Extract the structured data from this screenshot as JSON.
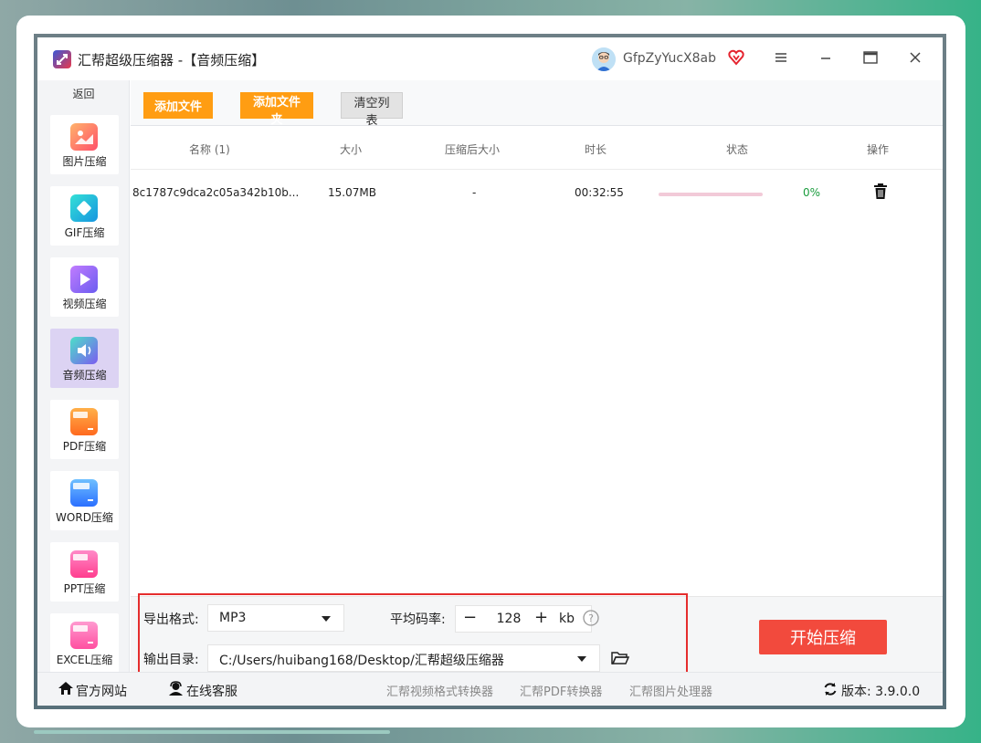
{
  "window": {
    "app_name": "汇帮超级压缩器",
    "section": " -【音频压缩】",
    "username": "GfpZyYucX8ab"
  },
  "sidebar": {
    "back_label": "返回",
    "items": [
      {
        "label": "图片压缩",
        "color": "#ff6b5a"
      },
      {
        "label": "GIF压缩",
        "color": "#19c2d8"
      },
      {
        "label": "视频压缩",
        "color": "#8a5cf6"
      },
      {
        "label": "音频压缩",
        "color": "#6a7ff0"
      },
      {
        "label": "PDF压缩",
        "color": "#ff7a2a"
      },
      {
        "label": "WORD压缩",
        "color": "#3a8bff"
      },
      {
        "label": "PPT压缩",
        "color": "#ff4fa0"
      },
      {
        "label": "EXCEL压缩",
        "color": "#ff5fa8"
      }
    ]
  },
  "toolbar": {
    "add_file": "添加文件",
    "add_folder": "添加文件夹",
    "clear_list": "清空列表"
  },
  "table": {
    "headers": [
      "名称 (1)",
      "大小",
      "压缩后大小",
      "时长",
      "状态",
      "操作"
    ],
    "rows": [
      {
        "name": "8c1787c9dca2c05a342b10b...",
        "size": "15.07MB",
        "compressed": "-",
        "duration": "00:32:55",
        "progress": "0%"
      }
    ]
  },
  "settings": {
    "format_label": "导出格式:",
    "format_value": "MP3",
    "bitrate_label": "平均码率:",
    "bitrate_value": "128",
    "bitrate_unit": "kb",
    "output_label": "输出目录:",
    "output_value": "C:/Users/huibang168/Desktop/汇帮超级压缩器",
    "start_button": "开始压缩"
  },
  "statusbar": {
    "website": "官方网站",
    "support": "在线客服",
    "links": [
      "汇帮视频格式转换器",
      "汇帮PDF转换器",
      "汇帮图片处理器"
    ],
    "version_label": "版本:",
    "version_value": "3.9.0.0"
  },
  "colors": {
    "accent_orange": "#ff9d12",
    "start_red": "#f24a3d",
    "highlight_red": "#e52d2d",
    "active_nav": "#dcd3f3"
  }
}
